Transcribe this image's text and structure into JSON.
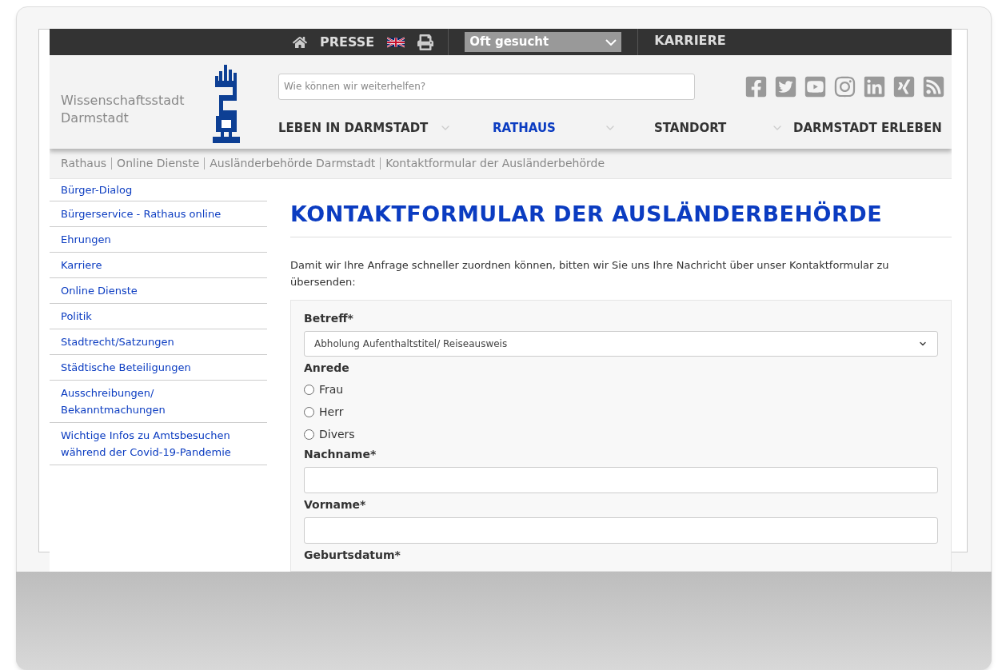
{
  "top_bar": {
    "presse": "PRESSE",
    "quick_select": "Oft gesucht",
    "karriere": "KARRIERE"
  },
  "header": {
    "site_name": [
      "Wissenschaftsstadt",
      "Darmstadt"
    ],
    "search": {
      "placeholder": "Wie können wir weiterhelfen?"
    },
    "nav": [
      {
        "label": "LEBEN IN DARMSTADT",
        "selected": false,
        "has_menu": true
      },
      {
        "label": "RATHAUS",
        "selected": true,
        "has_menu": true
      },
      {
        "label": "STANDORT",
        "selected": false,
        "has_menu": true
      },
      {
        "label": "DARMSTADT ERLEBEN",
        "selected": false,
        "has_menu": false
      }
    ]
  },
  "breadcrumb": [
    "Rathaus",
    "Online Dienste",
    "Ausländerbehörde Darmstadt",
    "Kontaktformular der Ausländerbehörde"
  ],
  "sidebar": {
    "items": [
      "Bürger-Dialog",
      "Bürgerservice - Rathaus online",
      "Ehrungen",
      "Karriere",
      "Online Dienste",
      "Politik",
      "Stadtrecht/Satzungen",
      "Städtische Beteiligungen",
      "Ausschreibungen/ Bekanntmachungen",
      "Wichtige Infos zu Amtsbesuchen während der Covid-19-Pandemie"
    ]
  },
  "main": {
    "title": "KONTAKTFORMULAR DER AUSLÄNDERBEHÖRDE",
    "intro": "Damit wir Ihre Anfrage schneller zuordnen können, bitten wir Sie uns Ihre Nachricht über unser Kontaktformular zu übersenden:",
    "form": [
      {
        "kind": "select",
        "label": "Betreff*",
        "value": "Abholung Aufenthaltstitel/ Reiseausweis"
      },
      {
        "kind": "radio",
        "label": "Anrede",
        "options": [
          {
            "label": "Frau",
            "selected": false
          },
          {
            "label": "Herr",
            "selected": false
          },
          {
            "label": "Divers",
            "selected": false
          }
        ]
      },
      {
        "kind": "text",
        "label": "Nachname*"
      },
      {
        "kind": "text",
        "label": "Vorname*"
      },
      {
        "kind": "label",
        "label": "Geburtsdatum*"
      }
    ]
  }
}
